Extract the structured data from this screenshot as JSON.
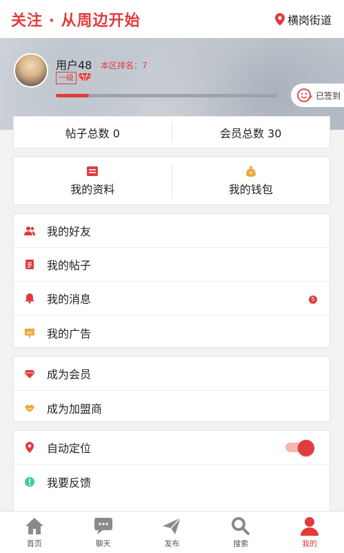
{
  "header": {
    "brand": "关注 · 从周边开始",
    "location": "横岗街道"
  },
  "profile": {
    "name": "用户48",
    "rank": "本区排名：7",
    "level": "一级",
    "progress_fraction": 0.15,
    "checkin_label": "已签到"
  },
  "stats": {
    "posts": "帖子总数 0",
    "members": "会员总数 30"
  },
  "quick": {
    "profile_label": "我的资料",
    "wallet_label": "我的钱包"
  },
  "menu1": [
    {
      "label": "我的好友",
      "icon": "friends-icon"
    },
    {
      "label": "我的帖子",
      "icon": "posts-icon"
    },
    {
      "label": "我的消息",
      "icon": "bell-icon",
      "badge": "5"
    },
    {
      "label": "我的广告",
      "icon": "ad-icon"
    }
  ],
  "menu2": [
    {
      "label": "成为会员",
      "icon": "diamond-icon"
    },
    {
      "label": "成为加盟商",
      "icon": "handshake-icon"
    }
  ],
  "menu3": [
    {
      "label": "自动定位",
      "icon": "location-pin-icon",
      "toggle_on": true
    },
    {
      "label": "我要反馈",
      "icon": "exclamation-icon"
    }
  ],
  "tabs": [
    {
      "label": "首页",
      "icon": "home-icon"
    },
    {
      "label": "聊天",
      "icon": "chat-icon"
    },
    {
      "label": "发布",
      "icon": "send-icon"
    },
    {
      "label": "搜索",
      "icon": "search-icon"
    },
    {
      "label": "我的",
      "icon": "user-icon",
      "active": true
    }
  ],
  "colors": {
    "accent": "#e23b3b",
    "background": "#f2f2f2",
    "toggle_track": "#f6b6b6"
  }
}
